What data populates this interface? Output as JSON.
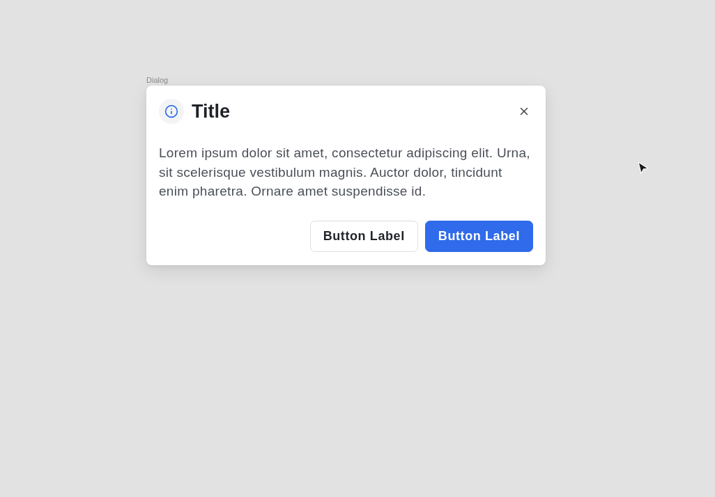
{
  "canvas_label": "Dialog",
  "dialog": {
    "title": "Title",
    "body": "Lorem ipsum dolor sit amet, consectetur adipiscing elit. Urna, sit scelerisque vestibulum magnis. Auctor dolor, tincidunt enim pharetra. Ornare amet suspendisse id.",
    "buttons": [
      {
        "label": "Button Label",
        "kind": "secondary"
      },
      {
        "label": "Button Label",
        "kind": "primary"
      }
    ]
  }
}
